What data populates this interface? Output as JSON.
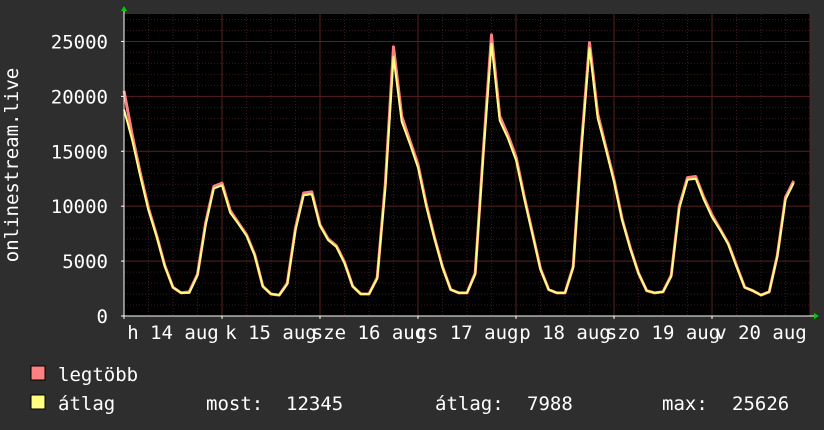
{
  "chart_data": {
    "type": "line",
    "ylabel": "onlinestream.live",
    "ylim": [
      0,
      27500
    ],
    "y_ticks": [
      0,
      5000,
      10000,
      15000,
      20000,
      25000
    ],
    "x_domain": [
      "2023-08-14",
      "2023-08-21"
    ],
    "x_tick_labels": [
      {
        "date": "2023-08-14",
        "label": "h 14 aug"
      },
      {
        "date": "2023-08-15",
        "label": "k 15 aug"
      },
      {
        "date": "2023-08-16",
        "label": "sze 16 aug"
      },
      {
        "date": "2023-08-17",
        "label": "cs 17 aug"
      },
      {
        "date": "2023-08-18",
        "label": "p 18 aug"
      },
      {
        "date": "2023-08-19",
        "label": "szo 19 aug"
      },
      {
        "date": "2023-08-20",
        "label": "v 20 aug"
      }
    ],
    "grid": true,
    "x": [
      "2023-08-14 00:00",
      "2023-08-14 02:00",
      "2023-08-14 04:00",
      "2023-08-14 06:00",
      "2023-08-14 08:00",
      "2023-08-14 10:00",
      "2023-08-14 12:00",
      "2023-08-14 14:00",
      "2023-08-14 16:00",
      "2023-08-14 18:00",
      "2023-08-14 20:00",
      "2023-08-14 22:00",
      "2023-08-15 00:00",
      "2023-08-15 02:00",
      "2023-08-15 04:00",
      "2023-08-15 06:00",
      "2023-08-15 08:00",
      "2023-08-15 10:00",
      "2023-08-15 12:00",
      "2023-08-15 14:00",
      "2023-08-15 16:00",
      "2023-08-15 18:00",
      "2023-08-15 20:00",
      "2023-08-15 22:00",
      "2023-08-16 00:00",
      "2023-08-16 02:00",
      "2023-08-16 04:00",
      "2023-08-16 06:00",
      "2023-08-16 08:00",
      "2023-08-16 10:00",
      "2023-08-16 12:00",
      "2023-08-16 14:00",
      "2023-08-16 16:00",
      "2023-08-16 18:00",
      "2023-08-16 20:00",
      "2023-08-16 22:00",
      "2023-08-17 00:00",
      "2023-08-17 02:00",
      "2023-08-17 04:00",
      "2023-08-17 06:00",
      "2023-08-17 08:00",
      "2023-08-17 10:00",
      "2023-08-17 12:00",
      "2023-08-17 14:00",
      "2023-08-17 16:00",
      "2023-08-17 18:00",
      "2023-08-17 20:00",
      "2023-08-17 22:00",
      "2023-08-18 00:00",
      "2023-08-18 02:00",
      "2023-08-18 04:00",
      "2023-08-18 06:00",
      "2023-08-18 08:00",
      "2023-08-18 10:00",
      "2023-08-18 12:00",
      "2023-08-18 14:00",
      "2023-08-18 16:00",
      "2023-08-18 18:00",
      "2023-08-18 20:00",
      "2023-08-18 22:00",
      "2023-08-19 00:00",
      "2023-08-19 02:00",
      "2023-08-19 04:00",
      "2023-08-19 06:00",
      "2023-08-19 08:00",
      "2023-08-19 10:00",
      "2023-08-19 12:00",
      "2023-08-19 14:00",
      "2023-08-19 16:00",
      "2023-08-19 18:00",
      "2023-08-19 20:00",
      "2023-08-19 22:00",
      "2023-08-20 00:00",
      "2023-08-20 02:00",
      "2023-08-20 04:00",
      "2023-08-20 06:00",
      "2023-08-20 08:00",
      "2023-08-20 10:00",
      "2023-08-20 12:00",
      "2023-08-20 14:00",
      "2023-08-20 16:00",
      "2023-08-20 18:00",
      "2023-08-20 20:00",
      "2023-08-20 22:00",
      "2023-08-21 00:00"
    ],
    "series": [
      {
        "name": "legtöbb",
        "color": "#ff8080",
        "values": [
          20500,
          16500,
          13000,
          9800,
          7300,
          4600,
          2600,
          2100,
          2200,
          3800,
          8500,
          11800,
          12100,
          9600,
          8500,
          7400,
          5600,
          2700,
          2000,
          1900,
          3000,
          8000,
          11200,
          11300,
          8300,
          7000,
          6400,
          4900,
          2700,
          2000,
          2000,
          3500,
          12000,
          24500,
          18200,
          16000,
          13800,
          10200,
          7200,
          4500,
          2400,
          2100,
          2100,
          3900,
          15000,
          25600,
          18200,
          16500,
          14500,
          10900,
          7600,
          4300,
          2400,
          2100,
          2100,
          4500,
          15400,
          24900,
          18400,
          15400,
          12400,
          8800,
          6200,
          3900,
          2300,
          2100,
          2200,
          3700,
          10000,
          12600,
          12700,
          10800,
          9200,
          7900,
          6600,
          4600,
          2600,
          2300,
          1900,
          2200,
          5500,
          10800,
          12300
        ]
      },
      {
        "name": "átlag",
        "color": "#ffff80",
        "values": [
          18800,
          16000,
          12700,
          9600,
          7200,
          4500,
          2600,
          2100,
          2100,
          3700,
          8300,
          11600,
          11900,
          9400,
          8400,
          7300,
          5500,
          2700,
          2000,
          1900,
          2900,
          7800,
          11000,
          11100,
          8200,
          6900,
          6300,
          4800,
          2700,
          2000,
          2000,
          3400,
          11600,
          23600,
          17700,
          15700,
          13500,
          10000,
          7100,
          4400,
          2400,
          2100,
          2100,
          3800,
          14600,
          24800,
          17800,
          16200,
          14200,
          10700,
          7500,
          4200,
          2400,
          2100,
          2100,
          4400,
          15000,
          24400,
          18000,
          15200,
          12200,
          8700,
          6100,
          3900,
          2300,
          2100,
          2200,
          3600,
          9800,
          12400,
          12500,
          10600,
          9000,
          7800,
          6500,
          4500,
          2600,
          2300,
          1900,
          2200,
          5400,
          10600,
          12100
        ]
      }
    ]
  },
  "stats": {
    "most_label": "most:",
    "most_value": "12345",
    "atlag_label": "átlag:",
    "atlag_value": "7988",
    "max_label": "max:",
    "max_value": "25626"
  },
  "colors": {
    "background": "#2e2e2e",
    "canvas": "#000000",
    "grid_minor": "#3a1a1a",
    "grid_major": "#5a2020",
    "axis": "#ffffff",
    "axis_arrow": "#00cc00"
  }
}
